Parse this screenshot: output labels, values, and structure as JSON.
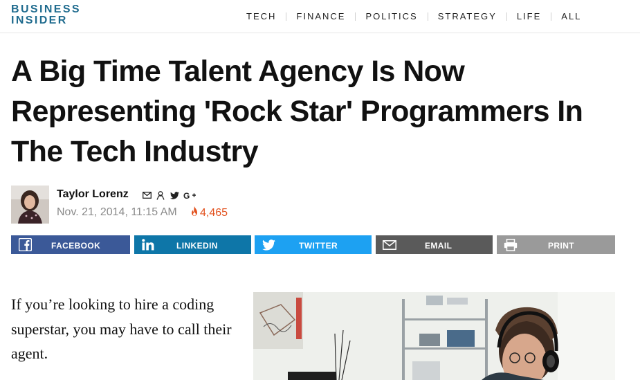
{
  "header": {
    "logo_line1": "BUSINESS",
    "logo_line2": "INSIDER",
    "brand_color": "#1f6b8e",
    "nav": [
      "TECH",
      "FINANCE",
      "POLITICS",
      "STRATEGY",
      "LIFE",
      "ALL"
    ]
  },
  "article": {
    "headline": "A Big Time Talent Agency Is Now Representing 'Rock Star' Programmers In The Tech Industry",
    "author": "Taylor Lorenz",
    "author_icons": [
      "mail-icon",
      "user-icon",
      "twitter-icon",
      "google-plus-icon"
    ],
    "date": "Nov. 21, 2014, 11:15 AM",
    "views": "4,465",
    "lede": "If you’re looking to hire a coding superstar, you may have to call their agent."
  },
  "share": {
    "facebook": "FACEBOOK",
    "linkedin": "LINKEDIN",
    "twitter": "TWITTER",
    "email": "EMAIL",
    "print": "PRINT",
    "colors": {
      "facebook": "#3b5998",
      "linkedin": "#0e76a8",
      "twitter": "#1da1f2",
      "email": "#5a5a5a",
      "print": "#9a9a9a"
    }
  }
}
